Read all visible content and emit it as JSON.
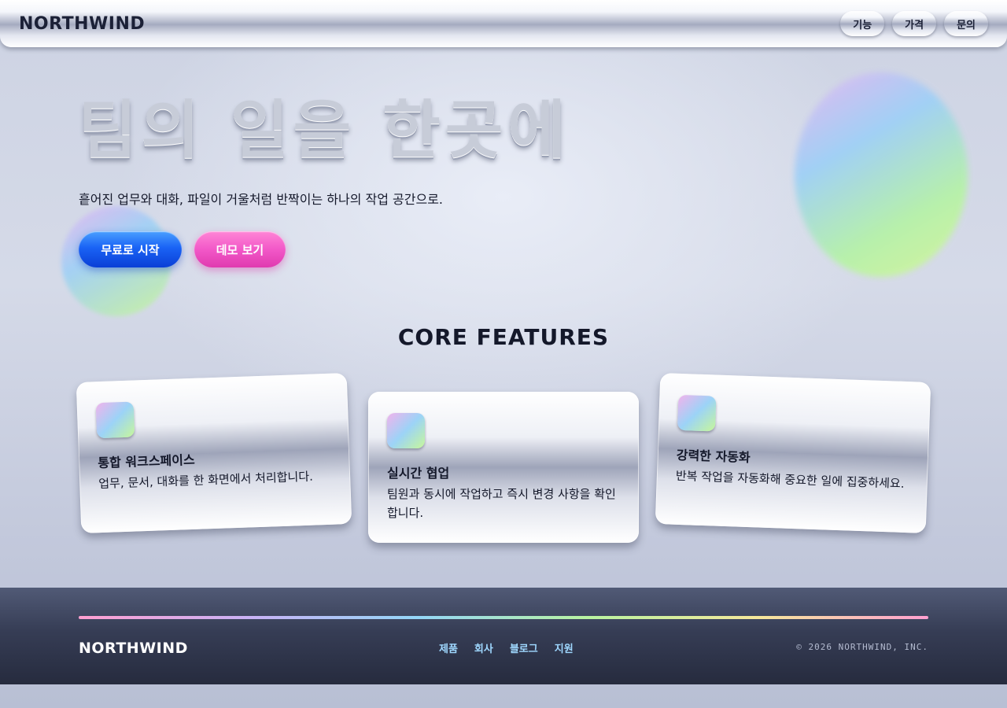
{
  "header": {
    "logo": "NORTHWIND",
    "nav": [
      {
        "label": "기능"
      },
      {
        "label": "가격"
      },
      {
        "label": "문의"
      }
    ]
  },
  "hero": {
    "title": "팀의 일을 한곳에",
    "subtitle": "흩어진 업무와 대화, 파일이 거울처럼 반짝이는 하나의 작업 공간으로.",
    "primary_button": "무료로 시작",
    "secondary_button": "데모 보기"
  },
  "features": {
    "title": "CORE FEATURES",
    "cards": [
      {
        "title": "통합 워크스페이스",
        "description": "업무, 문서, 대화를 한 화면에서 처리합니다."
      },
      {
        "title": "실시간 협업",
        "description": "팀원과 동시에 작업하고 즉시 변경 사항을 확인합니다."
      },
      {
        "title": "강력한 자동화",
        "description": "반복 작업을 자동화해 중요한 일에 집중하세요."
      }
    ]
  },
  "footer": {
    "logo": "NORTHWIND",
    "links": [
      {
        "label": "제품"
      },
      {
        "label": "회사"
      },
      {
        "label": "블로그"
      },
      {
        "label": "지원"
      }
    ],
    "copyright": "© 2026 NORTHWIND, INC."
  },
  "colors": {
    "primary": "#1a63f5",
    "secondary": "#f258c8",
    "footer_link": "#9fd8ff",
    "text": "#14182a"
  }
}
